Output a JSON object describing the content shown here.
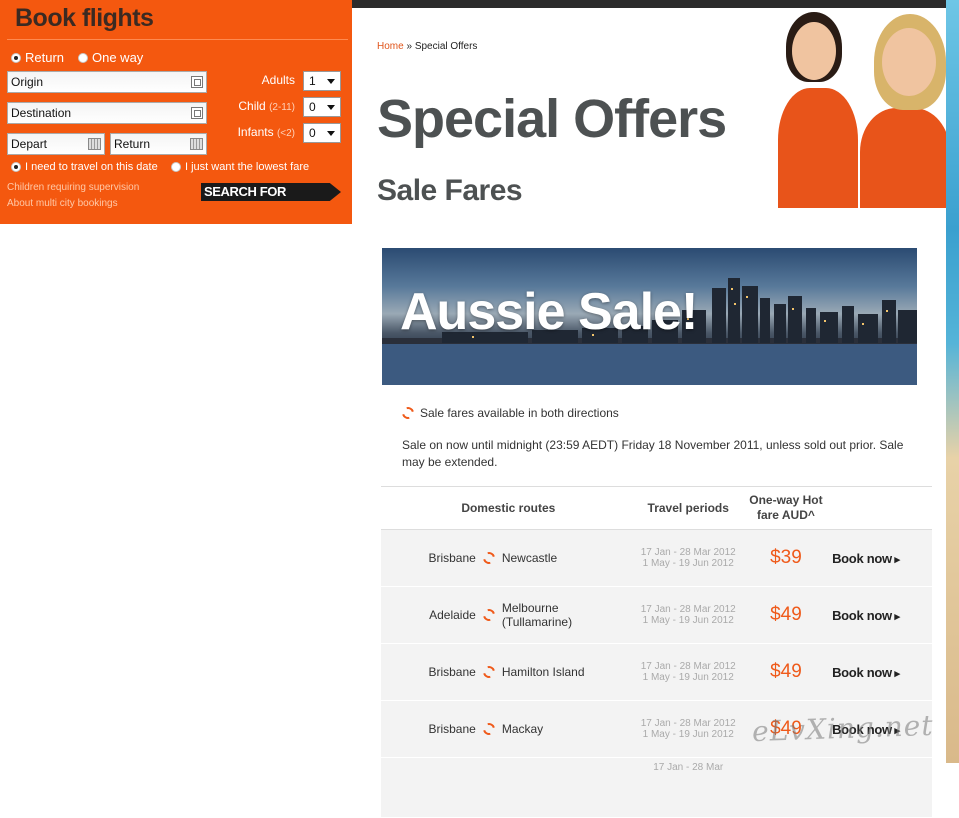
{
  "booking": {
    "title": "Book flights",
    "trip_options": [
      "Return",
      "One way"
    ],
    "origin_value": "Origin",
    "destination_value": "Destination",
    "depart_value": "Depart",
    "return_value": "Return",
    "adults_label": "Adults",
    "child_label": "Child",
    "child_note": "(2-11)",
    "infants_label": "Infants",
    "infants_note": "(<2)",
    "adults_value": "1",
    "child_value": "0",
    "infants_value": "0",
    "date_options": [
      "I need to travel on this date",
      "I just want the lowest fare"
    ],
    "link_supervision": "Children requiring supervision",
    "link_multicity": "About multi city bookings",
    "search_label": "SEARCH FOR FLIGHTS"
  },
  "breadcrumb": {
    "home": "Home",
    "separator": "»",
    "current": "Special Offers"
  },
  "page": {
    "title": "Special Offers",
    "subtitle": "Sale Fares",
    "banner_text": "Aussie Sale!",
    "note": "Sale fares available in both directions",
    "description": "Sale on now until midnight (23:59 AEDT) Friday 18 November 2011, unless sold out prior. Sale may be extended."
  },
  "table": {
    "headers": [
      "Domestic routes",
      "Travel periods",
      "One-way Hot fare AUD^"
    ],
    "rows": [
      {
        "from": "Brisbane",
        "to": "Newcastle",
        "period1": "17 Jan - 28 Mar 2012",
        "period2": "1 May - 19 Jun 2012",
        "price": "$39",
        "action": "Book now"
      },
      {
        "from": "Adelaide",
        "to": "Melbourne (Tullamarine)",
        "period1": "17 Jan - 28 Mar 2012",
        "period2": "1 May - 19 Jun 2012",
        "price": "$49",
        "action": "Book now"
      },
      {
        "from": "Brisbane",
        "to": "Hamilton Island",
        "period1": "17 Jan - 28 Mar 2012",
        "period2": "1 May - 19 Jun 2012",
        "price": "$49",
        "action": "Book now"
      },
      {
        "from": "Brisbane",
        "to": "Mackay",
        "period1": "17 Jan - 28 Mar 2012",
        "period2": "1 May - 19 Jun 2012",
        "price": "$49",
        "action": "Book now"
      },
      {
        "from": "",
        "to": "",
        "period1": "17 Jan - 28 Mar",
        "period2": "",
        "price": "",
        "action": ""
      }
    ]
  },
  "watermark": "eLvXing.net",
  "colors": {
    "brand": "#f4580f",
    "price": "#ef5a1a",
    "heading": "#4d5152"
  }
}
